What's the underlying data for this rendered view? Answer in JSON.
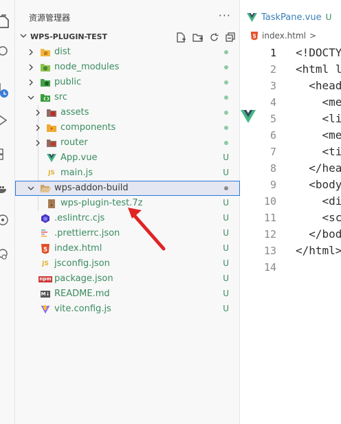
{
  "sidebar": {
    "title": "资源管理器",
    "more": "···",
    "project_name": "WPS-PLUGIN-TEST"
  },
  "tree": [
    {
      "label": "dist",
      "status": "",
      "dot": true,
      "icon": "folder-dist-icon",
      "icon_color": "#f2b63d",
      "label_color": "#3a8c5f"
    },
    {
      "label": "node_modules",
      "status": "",
      "dot": true,
      "icon": "folder-node-icon",
      "icon_color": "#7cb342",
      "label_color": "#3a8c5f"
    },
    {
      "label": "public",
      "status": "",
      "dot": true,
      "icon": "folder-public-icon",
      "icon_color": "#3a9c3a",
      "label_color": "#3a8c5f"
    },
    {
      "label": "src",
      "status": "",
      "dot": true,
      "icon": "folder-src-icon",
      "icon_color": "#3a9c3a",
      "label_color": "#3a8c5f"
    },
    {
      "label": "assets",
      "status": "",
      "dot": true,
      "icon": "folder-assets-icon",
      "icon_color": "#c0392b",
      "label_color": "#3a8c5f"
    },
    {
      "label": "components",
      "status": "",
      "dot": true,
      "icon": "folder-components-icon",
      "icon_color": "#e6a23c",
      "label_color": "#3a8c5f"
    },
    {
      "label": "router",
      "status": "",
      "dot": true,
      "icon": "folder-router-icon",
      "icon_color": "#c0392b",
      "label_color": "#3a8c5f"
    },
    {
      "label": "App.vue",
      "status": "U",
      "dot": false,
      "icon": "vue-icon",
      "icon_color": "#41b883",
      "label_color": "#3a8c5f"
    },
    {
      "label": "main.js",
      "status": "U",
      "dot": false,
      "icon": "js-icon",
      "icon_color": "#e0b533",
      "label_color": "#3a8c5f"
    },
    {
      "label": "wps-addon-build",
      "status": "",
      "dot": true,
      "icon": "folder-open-icon",
      "icon_color": "#d9b77a",
      "label_color": "#3b3b3b"
    },
    {
      "label": "wps-plugin-test.7z",
      "status": "U",
      "dot": false,
      "icon": "archive-icon",
      "icon_color": "#a67c52",
      "label_color": "#3a8c5f"
    },
    {
      "label": ".eslintrc.cjs",
      "status": "U",
      "dot": false,
      "icon": "eslint-icon",
      "icon_color": "#4b32c3",
      "label_color": "#3a8c5f"
    },
    {
      "label": ".prettierrc.json",
      "status": "U",
      "dot": false,
      "icon": "prettier-icon",
      "icon_color": "#56b3b4",
      "label_color": "#3a8c5f"
    },
    {
      "label": "index.html",
      "status": "U",
      "dot": false,
      "icon": "html-icon",
      "icon_color": "#e44d26",
      "label_color": "#3a8c5f"
    },
    {
      "label": "jsconfig.json",
      "status": "U",
      "dot": false,
      "icon": "jsconfig-icon",
      "icon_color": "#e0b533",
      "label_color": "#3a8c5f"
    },
    {
      "label": "package.json",
      "status": "U",
      "dot": false,
      "icon": "npm-icon",
      "icon_color": "#cb3837",
      "label_color": "#3a8c5f"
    },
    {
      "label": "README.md",
      "status": "U",
      "dot": false,
      "icon": "markdown-icon",
      "icon_color": "#555555",
      "label_color": "#3a8c5f"
    },
    {
      "label": "vite.config.js",
      "status": "U",
      "dot": false,
      "icon": "vite-icon",
      "icon_color": "#8f67ff",
      "label_color": "#3a8c5f"
    }
  ],
  "icon_text": {
    "js": "JS",
    "md": "M↓",
    "npm": "npm",
    "html": "5"
  },
  "editor": {
    "tab_label": "TaskPane.vue",
    "tab_status": "U",
    "breadcrumb_file": "index.html",
    "breadcrumb_sep": ">",
    "lines": [
      {
        "n": "1",
        "text": "<!DOCTY"
      },
      {
        "n": "2",
        "text": "<html l"
      },
      {
        "n": "3",
        "text": "  <head"
      },
      {
        "n": "4",
        "text": "    <me"
      },
      {
        "n": "5",
        "text": "    <li"
      },
      {
        "n": "6",
        "text": "    <me"
      },
      {
        "n": "7",
        "text": "    <ti"
      },
      {
        "n": "8",
        "text": "  </hea"
      },
      {
        "n": "9",
        "text": "  <body"
      },
      {
        "n": "10",
        "text": "    <di"
      },
      {
        "n": "11",
        "text": "    <sc"
      },
      {
        "n": "12",
        "text": "  </bod"
      },
      {
        "n": "13",
        "text": "</html>"
      },
      {
        "n": "14",
        "text": ""
      }
    ]
  },
  "colors": {
    "untracked_green": "#3a8c5f",
    "selection_border": "#2a7ad8",
    "selection_bg": "#e4e6f1",
    "dot_green": "#8fc9a7",
    "dot_gray": "#8a8a8a",
    "arrow_red": "#e02424"
  }
}
